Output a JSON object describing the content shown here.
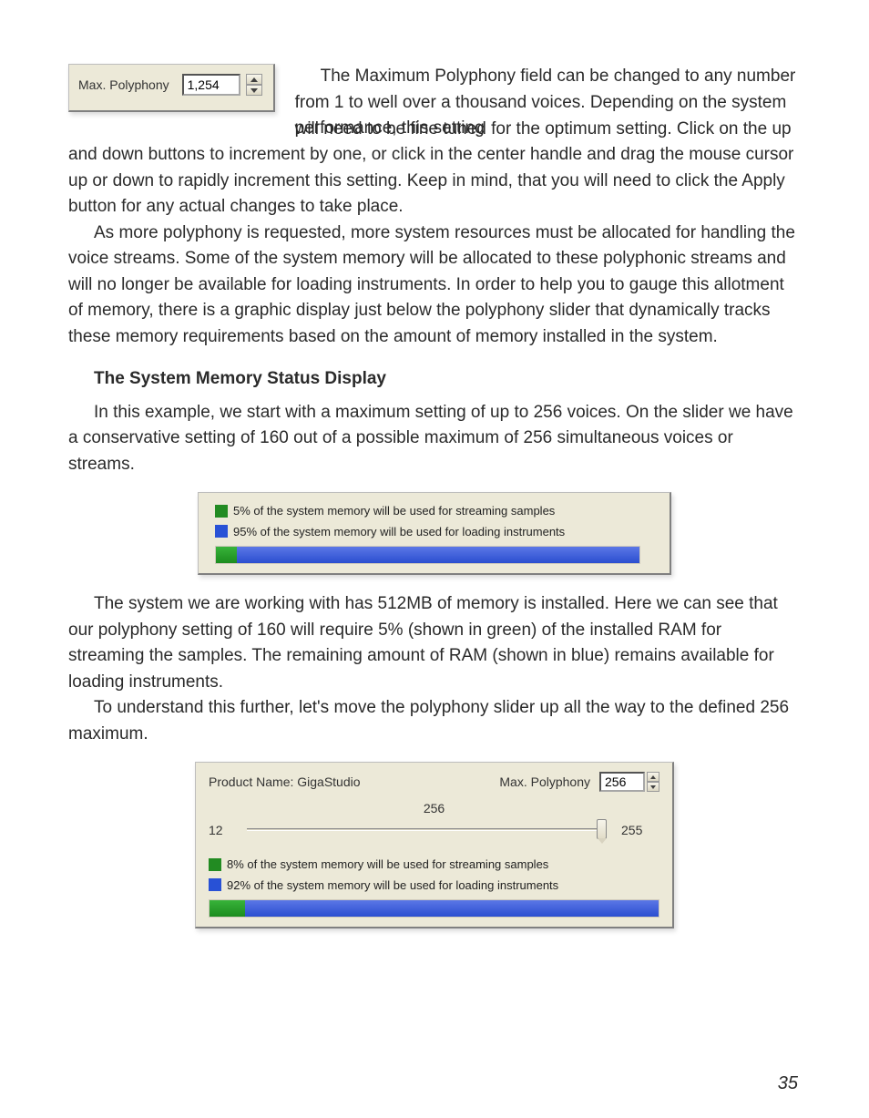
{
  "fig1": {
    "label": "Max. Polyphony",
    "value": "1,254"
  },
  "para1a": "The Maximum Polyphony field can be changed to any number from 1 to well over a thousand voices. Depending on the system performance, this setting ",
  "para1b": "will need to be fine tuned for the optimum setting. Click on the up and down buttons to increment by one, or click in the center handle and drag the mouse cursor up or down to rapidly increment this setting. Keep in mind, that you will need to click the Apply button for any actual changes to take place.",
  "para2": "As more polyphony is requested, more system resources must be allocated for handling the voice streams. Some of the system memory will be allocated to these polyphonic streams and will no longer be available for loading instruments. In order to help you to gauge this allotment of memory, there is a graphic display just below the polyphony slider that dynamically tracks these memory requirements based on the amount of memory installed in the system.",
  "subhead1": "The System Memory Status Display",
  "para3": "In this example, we start with a maximum setting of up to 256 voices. On the slider we have a conservative setting of 160 out of a possible maximum of 256 simultaneous voices or streams.",
  "fig2": {
    "line1": "5% of the system memory will be used for streaming samples",
    "line2": "95% of the system memory will be used for loading instruments",
    "greenPct": 5,
    "bluePct": 95
  },
  "para4": "The system we are working with has 512MB of memory is installed. Here we can see that our polyphony setting of 160 will require 5% (shown in green) of the installed RAM for streaming the samples. The remaining amount of RAM (shown in blue) remains available for loading instruments.",
  "para5": "To understand this further, let's move the polyphony slider up all the way to the defined 256 maximum.",
  "fig3": {
    "product_label": "Product Name: GigaStudio",
    "maxpoly_label": "Max. Polyphony",
    "maxpoly_value": "256",
    "slider_mark": "256",
    "slider_min": "12",
    "slider_max": "255",
    "line1": "8% of the system memory will be used for streaming samples",
    "line2": "92% of the system memory will be used for loading instruments",
    "greenPct": 8,
    "bluePct": 92
  },
  "page_number": "35"
}
